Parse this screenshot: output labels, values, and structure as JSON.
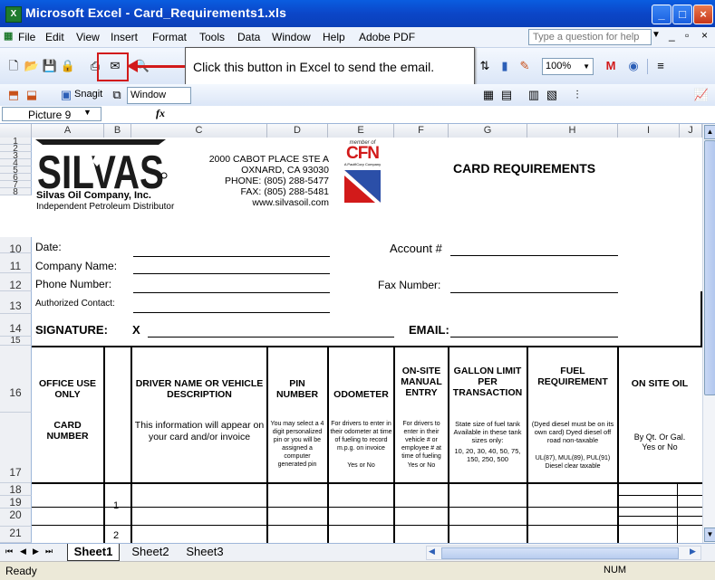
{
  "window": {
    "title": "Microsoft Excel - Card_Requirements1.xls",
    "app_icon": "excel-icon"
  },
  "menu": {
    "items": [
      "File",
      "Edit",
      "View",
      "Insert",
      "Format",
      "Tools",
      "Data",
      "Window",
      "Help",
      "Adobe PDF"
    ],
    "ask_placeholder": "Type a question for help"
  },
  "toolbar": {
    "zoom": "100%",
    "snagit_label": "Snagit",
    "window_label": "Window"
  },
  "callout": {
    "text": "Click this button in Excel to send the email."
  },
  "formula": {
    "name_box": "Picture 9",
    "fx": "fx"
  },
  "columns": [
    "A",
    "B",
    "C",
    "D",
    "E",
    "F",
    "G",
    "H",
    "I",
    "J"
  ],
  "rows": [
    "1",
    "2",
    "3",
    "4",
    "5",
    "6",
    "7",
    "8",
    "10",
    "11",
    "12",
    "13",
    "14",
    "15",
    "16",
    "17",
    "18",
    "19",
    "20",
    "21"
  ],
  "company": {
    "name": "Silvas Oil Company, Inc.",
    "tagline": "Independent Petroleum Distributor",
    "address1": "2000 CABOT PLACE STE A",
    "address2": "OXNARD, CA  93030",
    "phone": "PHONE: (805) 288-5477",
    "fax": "FAX: (805) 288-5481",
    "web": "www.silvasoil.com",
    "cfn_member": "member of",
    "cfn": "CFN",
    "cfn_sub": "A PacifiCorp Company"
  },
  "form": {
    "title": "CARD REQUIREMENTS",
    "date": "Date:",
    "account": "Account #",
    "company_name": "Company Name:",
    "phone_number": "Phone Number:",
    "fax_number": "Fax Number:",
    "authorized": "Authorized Contact:",
    "signature": "SIGNATURE:",
    "signature_x": "X",
    "email": "EMAIL:"
  },
  "table": {
    "office_use": "OFFICE USE ONLY",
    "card_number": "CARD NUMBER",
    "driver": "DRIVER NAME OR VEHICLE DESCRIPTION",
    "driver_note": "This information will appear on your card and/or invoice",
    "pin": "PIN NUMBER",
    "pin_note": "You may select a 4 digit personalized pin or you will be assigned a computer generated pin",
    "odometer": "ODOMETER",
    "odometer_note": "For drivers to enter in their odometer at time of fueling to record m.p.g. on invoice",
    "odometer_yn": "Yes or No",
    "onsite": "ON-SITE MANUAL ENTRY",
    "onsite_note": "For drivers to enter in their vehicle # or employee # at time of fueling",
    "onsite_yn": "Yes or No",
    "gallon": "GALLON LIMIT PER TRANSACTION",
    "gallon_note1": "State size of fuel tank Available in these tank sizes only:",
    "gallon_note2": "10, 20, 30, 40, 50, 75, 150, 250, 500",
    "fuel": "FUEL REQUIREMENT",
    "fuel_note1": "(Dyed diesel must be on its own card) Dyed diesel off road non-taxable",
    "fuel_note2": "UL(87), MUL(89), PUL(91) Diesel clear taxable",
    "onsite_oil": "ON SITE OIL",
    "onsite_oil_note": "By Qt. Or Gal. Yes or No",
    "row1": "1",
    "row2": "2"
  },
  "sheets": [
    "Sheet1",
    "Sheet2",
    "Sheet3"
  ],
  "status": {
    "left": "Ready",
    "num": "NUM"
  }
}
